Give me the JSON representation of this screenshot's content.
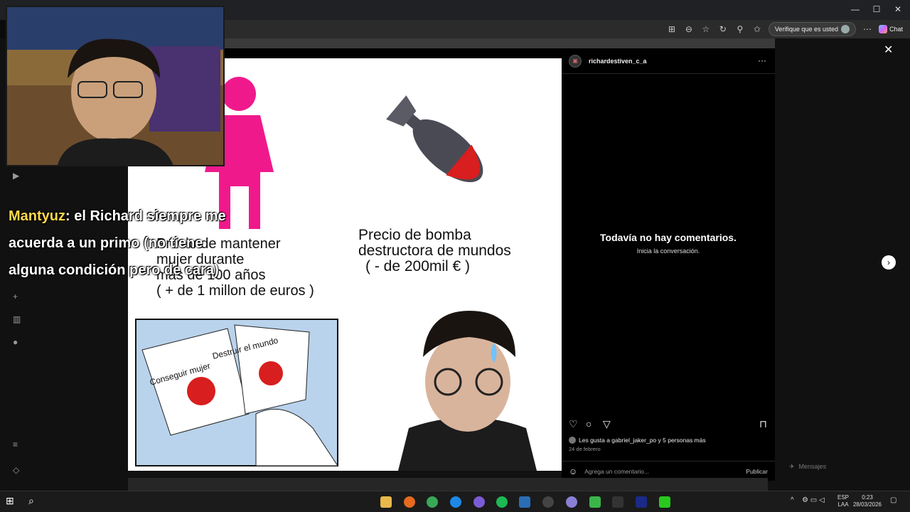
{
  "browser": {
    "verify_label": "Verifique que es usted",
    "chat_label": "Chat",
    "minimize": "—",
    "maximize": "☐",
    "close": "✕"
  },
  "post": {
    "username": "richardestiven_c_a",
    "more": "···",
    "no_comments_title": "Todavía no hay comentarios.",
    "no_comments_sub": "Inicia la conversación.",
    "likes_text": "Les gusta a gabriel_jaker_po y 5 personas más",
    "date": "24 de febrero",
    "comment_placeholder": "Agrega un comentario...",
    "publish_label": "Publicar"
  },
  "meme": {
    "left_text_l1": "Precio de mantener",
    "left_text_l2": "mujer durante",
    "left_text_l3": "mas de 100 años",
    "left_text_l4": "( + de 1 millon de euros )",
    "right_text_l1": "Precio de bomba",
    "right_text_l2": "destructora de mundos",
    "right_text_l3": "( - de 200mil € )",
    "button_left": "Conseguir mujer",
    "button_right": "Destruir el mundo"
  },
  "overlay": {
    "author": "Mantyuz",
    "line1": ": el Richard siempre me",
    "line2": "acuerda a un primo (no tiene",
    "line3": "alguna condición pero de cara)"
  },
  "messages": {
    "label": "Mensajes"
  },
  "taskbar": {
    "lang": "ESP",
    "lang2": "LAA",
    "time": "0:23",
    "date": "28/03/2026"
  },
  "colors": {
    "meme_pink": "#f0198c",
    "bomb_red": "#d81e1e",
    "button_panel": "#b9d3ec",
    "overlay_author": "#ffd84a"
  }
}
